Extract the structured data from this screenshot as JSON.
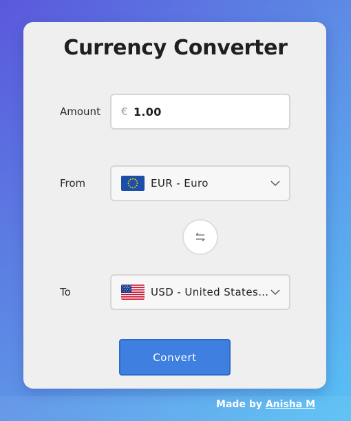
{
  "app": {
    "title": "Currency Converter"
  },
  "amount": {
    "label": "Amount",
    "symbol": "€",
    "value": "1.00"
  },
  "from": {
    "label": "From",
    "selected": "EUR - Euro",
    "flag": "eu-flag-icon"
  },
  "to": {
    "label": "To",
    "selected": "USD - United States Dollar",
    "flag": "us-flag-icon"
  },
  "swap": {
    "icon": "swap-arrows-icon"
  },
  "convert": {
    "label": "Convert"
  },
  "footer": {
    "prefix": "Made by",
    "author": "Anisha M"
  },
  "colors": {
    "accent": "#3f7fe0",
    "card": "#efefef",
    "gradient_start": "#5a58dc",
    "gradient_end": "#58c1f5"
  }
}
